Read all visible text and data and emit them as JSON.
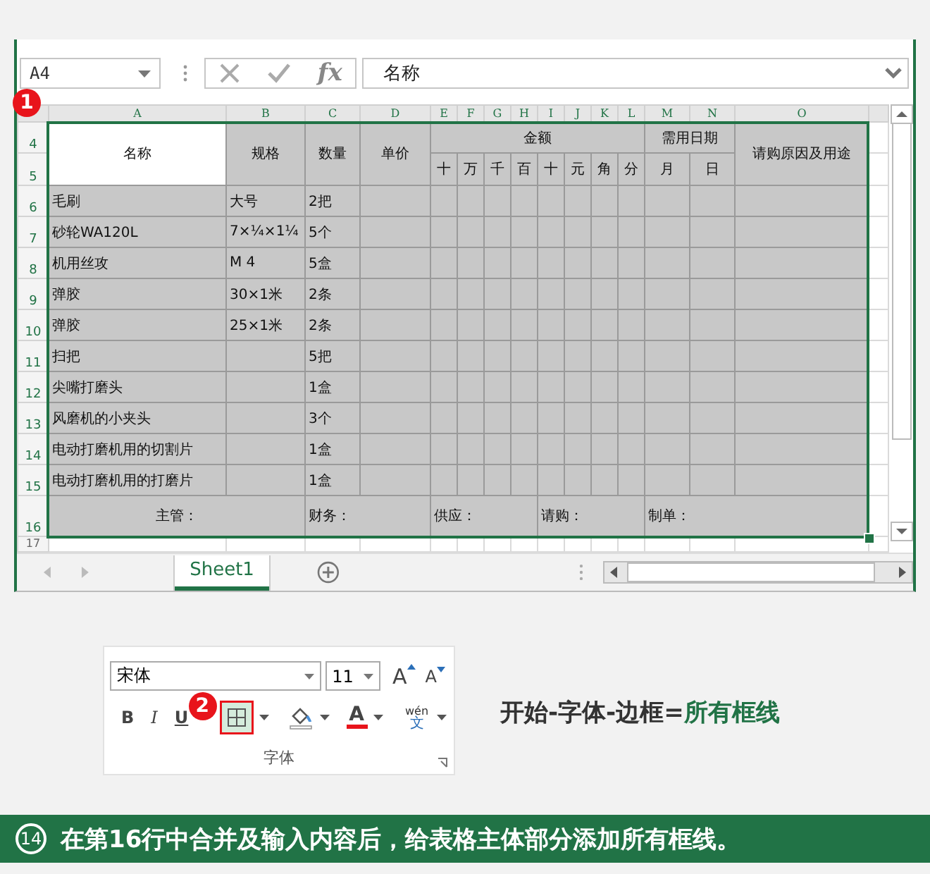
{
  "step_badges": [
    "1",
    "2"
  ],
  "formula_bar": {
    "name_box": "A4",
    "function_label": "fx",
    "formula": "名称"
  },
  "sheet": {
    "column_headers": [
      "A",
      "B",
      "C",
      "D",
      "E",
      "F",
      "G",
      "H",
      "I",
      "J",
      "K",
      "L",
      "M",
      "N",
      "O"
    ],
    "row_numbers": [
      "4",
      "5",
      "6",
      "7",
      "8",
      "9",
      "10",
      "11",
      "12",
      "13",
      "14",
      "15",
      "16",
      "17"
    ],
    "header": {
      "name": "名称",
      "spec": "规格",
      "qty": "数量",
      "price": "单价",
      "amount": "金额",
      "date": "需用日期",
      "purpose": "请购原因及用途"
    },
    "amount_units": [
      "十",
      "万",
      "千",
      "百",
      "十",
      "元",
      "角",
      "分"
    ],
    "date_parts": [
      "月",
      "日"
    ],
    "items": [
      {
        "name": "毛刷",
        "spec": "大号",
        "qty": "2把"
      },
      {
        "name": "砂轮WA120L",
        "spec": "7×¼×1¼",
        "qty": "5个"
      },
      {
        "name": "机用丝攻",
        "spec": "M 4",
        "qty": "5盒"
      },
      {
        "name": "弹胶",
        "spec": "30×1米",
        "qty": "2条"
      },
      {
        "name": "弹胶",
        "spec": "25×1米",
        "qty": "2条"
      },
      {
        "name": "扫把",
        "qty": "5把"
      },
      {
        "name": "尖嘴打磨头",
        "qty": "1盒"
      },
      {
        "name": "风磨机的小夹头",
        "qty": "3个"
      },
      {
        "name": "电动打磨机用的切割片",
        "qty": "1盒"
      },
      {
        "name": "电动打磨机用的打磨片",
        "qty": "1盒"
      }
    ],
    "signatures": [
      "主管：",
      "财务：",
      "供应：",
      "请购：",
      "制单："
    ],
    "sheet_tabs": [
      {
        "label": "Sheet1",
        "selected": true
      }
    ]
  },
  "font_group": {
    "font_name": "宋体",
    "font_size": "11",
    "grow_font": "A",
    "shrink_font": "A",
    "bold": "B",
    "italic": "I",
    "underline": "U",
    "borders_highlighted": true,
    "font_color": "A",
    "phonetic_top": "wén",
    "phonetic_bottom": "文",
    "label": "字体"
  },
  "instruction": {
    "text": "开始-字体-边框=",
    "highlight": "所有框线"
  },
  "caption": {
    "step": "14",
    "text": "在第16行中合并及输入内容后，给表格主体部分添加所有框线。"
  }
}
